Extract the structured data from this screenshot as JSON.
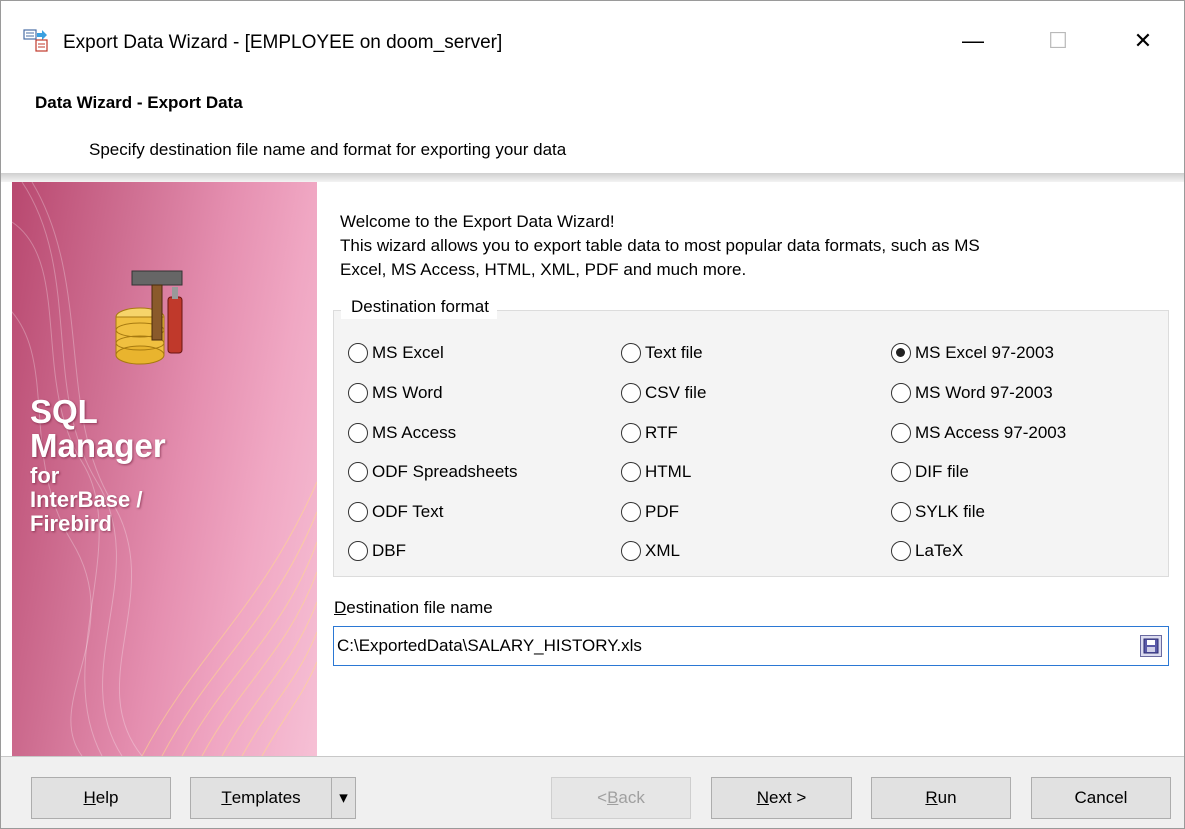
{
  "window": {
    "title": "Export Data Wizard - [EMPLOYEE on doom_server]",
    "icon": "export-wizard-icon",
    "controls": {
      "minimize": "—",
      "maximize": "☐",
      "close": "✕"
    }
  },
  "header": {
    "title": "Data Wizard - Export Data",
    "subtitle": "Specify destination file name and format for exporting your data"
  },
  "banner": {
    "line1": "SQL",
    "line2": "Manager",
    "line3": "for",
    "line4": "InterBase /",
    "line5": "Firebird",
    "colors": {
      "dark": "#b8486f",
      "light": "#f6c0d5"
    }
  },
  "welcome": {
    "line1": "Welcome to the Export Data Wizard!",
    "line2": "This wizard allows you to export table data to most popular data formats, such as MS",
    "line3": "Excel, MS Access, HTML, XML, PDF and much more."
  },
  "destination_format": {
    "legend": "Destination format",
    "selected": "MS Excel 97-2003",
    "col1": [
      "MS Excel",
      "MS Word",
      "MS Access",
      "ODF Spreadsheets",
      "ODF Text",
      "DBF"
    ],
    "col2": [
      "Text file",
      "CSV file",
      "RTF",
      "HTML",
      "PDF",
      "XML"
    ],
    "col3": [
      "MS Excel 97-2003",
      "MS Word 97-2003",
      "MS Access 97-2003",
      "DIF file",
      "SYLK file",
      "LaTeX"
    ]
  },
  "destination_file": {
    "label_first": "D",
    "label_rest": "estination file name",
    "value": "C:\\ExportedData\\SALARY_HISTORY.xls",
    "save_icon": "save-icon"
  },
  "buttons": {
    "help_u": "H",
    "help_rest": "elp",
    "templates_u": "T",
    "templates_rest": "emplates",
    "templates_arrow": "▾",
    "back_pre": "< ",
    "back_u": "B",
    "back_rest": "ack",
    "next_u": "N",
    "next_rest": "ext >",
    "run_u": "R",
    "run_rest": "un",
    "cancel": "Cancel"
  },
  "colors": {
    "accent": "#2b78d4",
    "button_face": "#e1e1e1"
  }
}
